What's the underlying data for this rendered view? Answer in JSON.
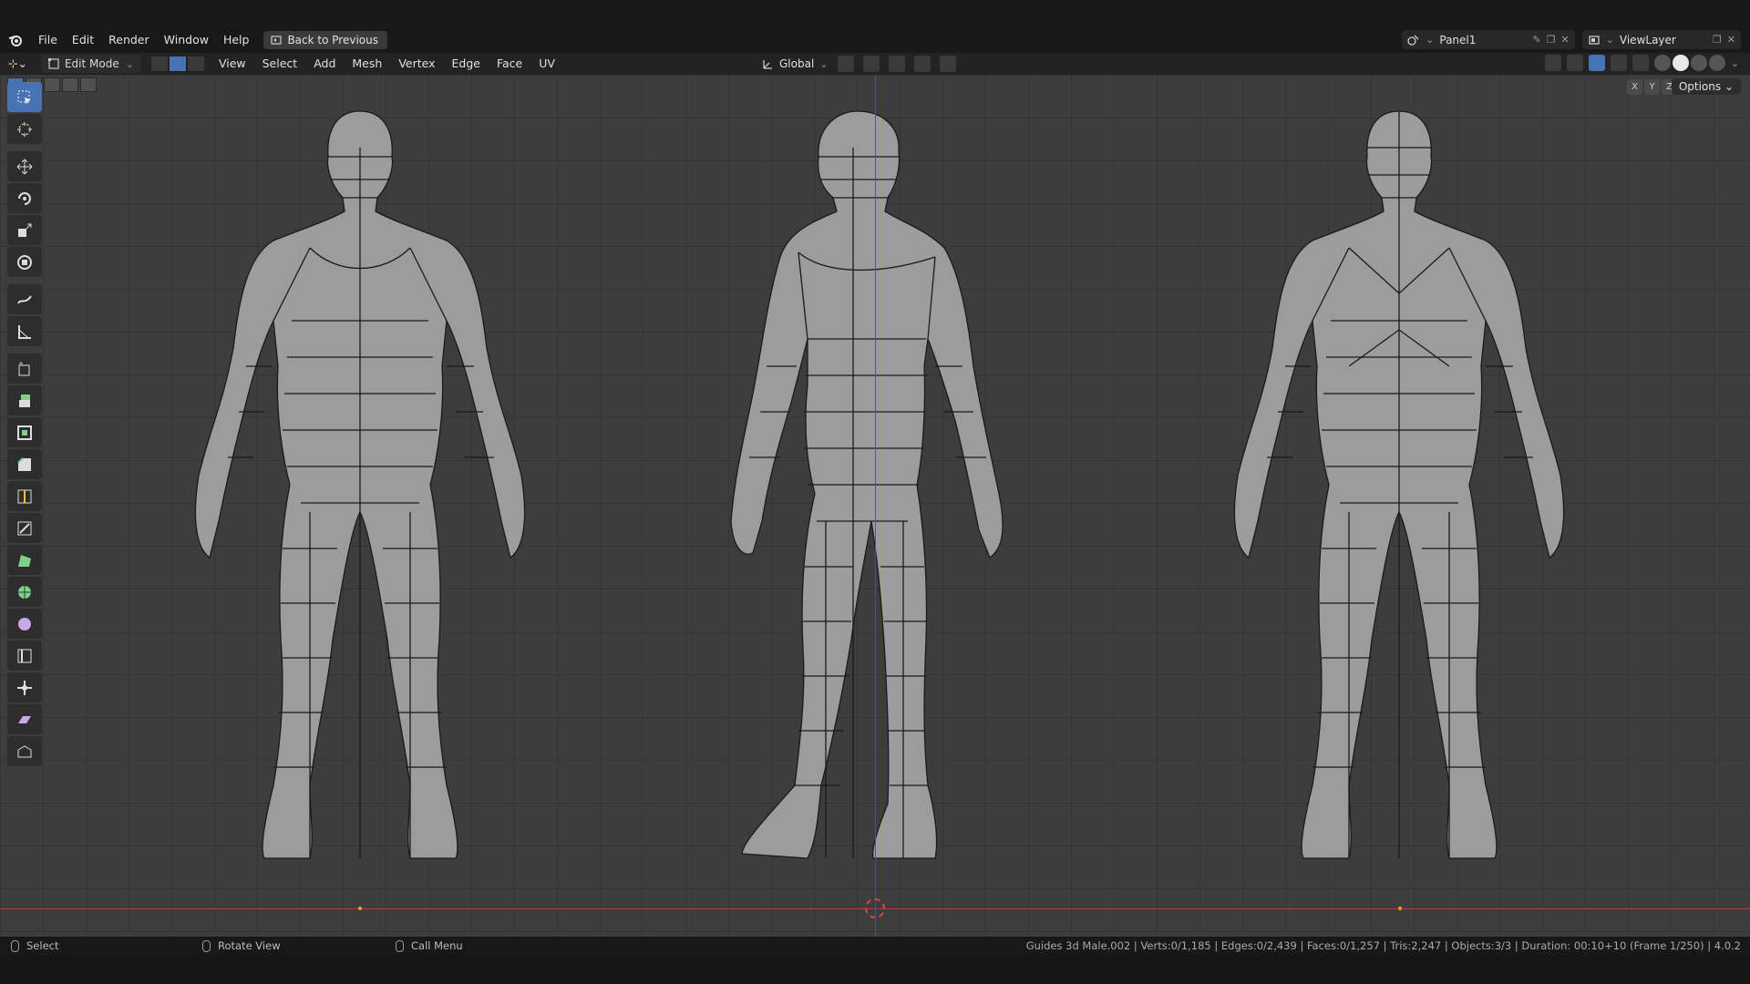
{
  "menubar": {
    "items": [
      "File",
      "Edit",
      "Render",
      "Window",
      "Help"
    ],
    "back_button": "Back to Previous"
  },
  "scene": {
    "name": "Panel1"
  },
  "view_layer": {
    "name": "ViewLayer"
  },
  "header": {
    "mode": "Edit Mode",
    "menus": [
      "View",
      "Select",
      "Add",
      "Mesh",
      "Vertex",
      "Edge",
      "Face",
      "UV"
    ],
    "orientation": "Global"
  },
  "viewport": {
    "axis": [
      "X",
      "Y",
      "Z"
    ],
    "options_label": "Options"
  },
  "statusbar": {
    "select": "Select",
    "rotate_view": "Rotate View",
    "call_menu": "Call Menu",
    "stats": "Guides 3d Male.002 | Verts:0/1,185 | Edges:0/2,439 | Faces:0/1,257 | Tris:2,247 | Objects:3/3 | Duration: 00:10+10 (Frame 1/250) | 4.0.2"
  },
  "colors": {
    "accent": "#4772b3",
    "x_axis": "#b23c3c",
    "z_axis": "#2b5bad",
    "mesh": "#9a9a9a"
  }
}
